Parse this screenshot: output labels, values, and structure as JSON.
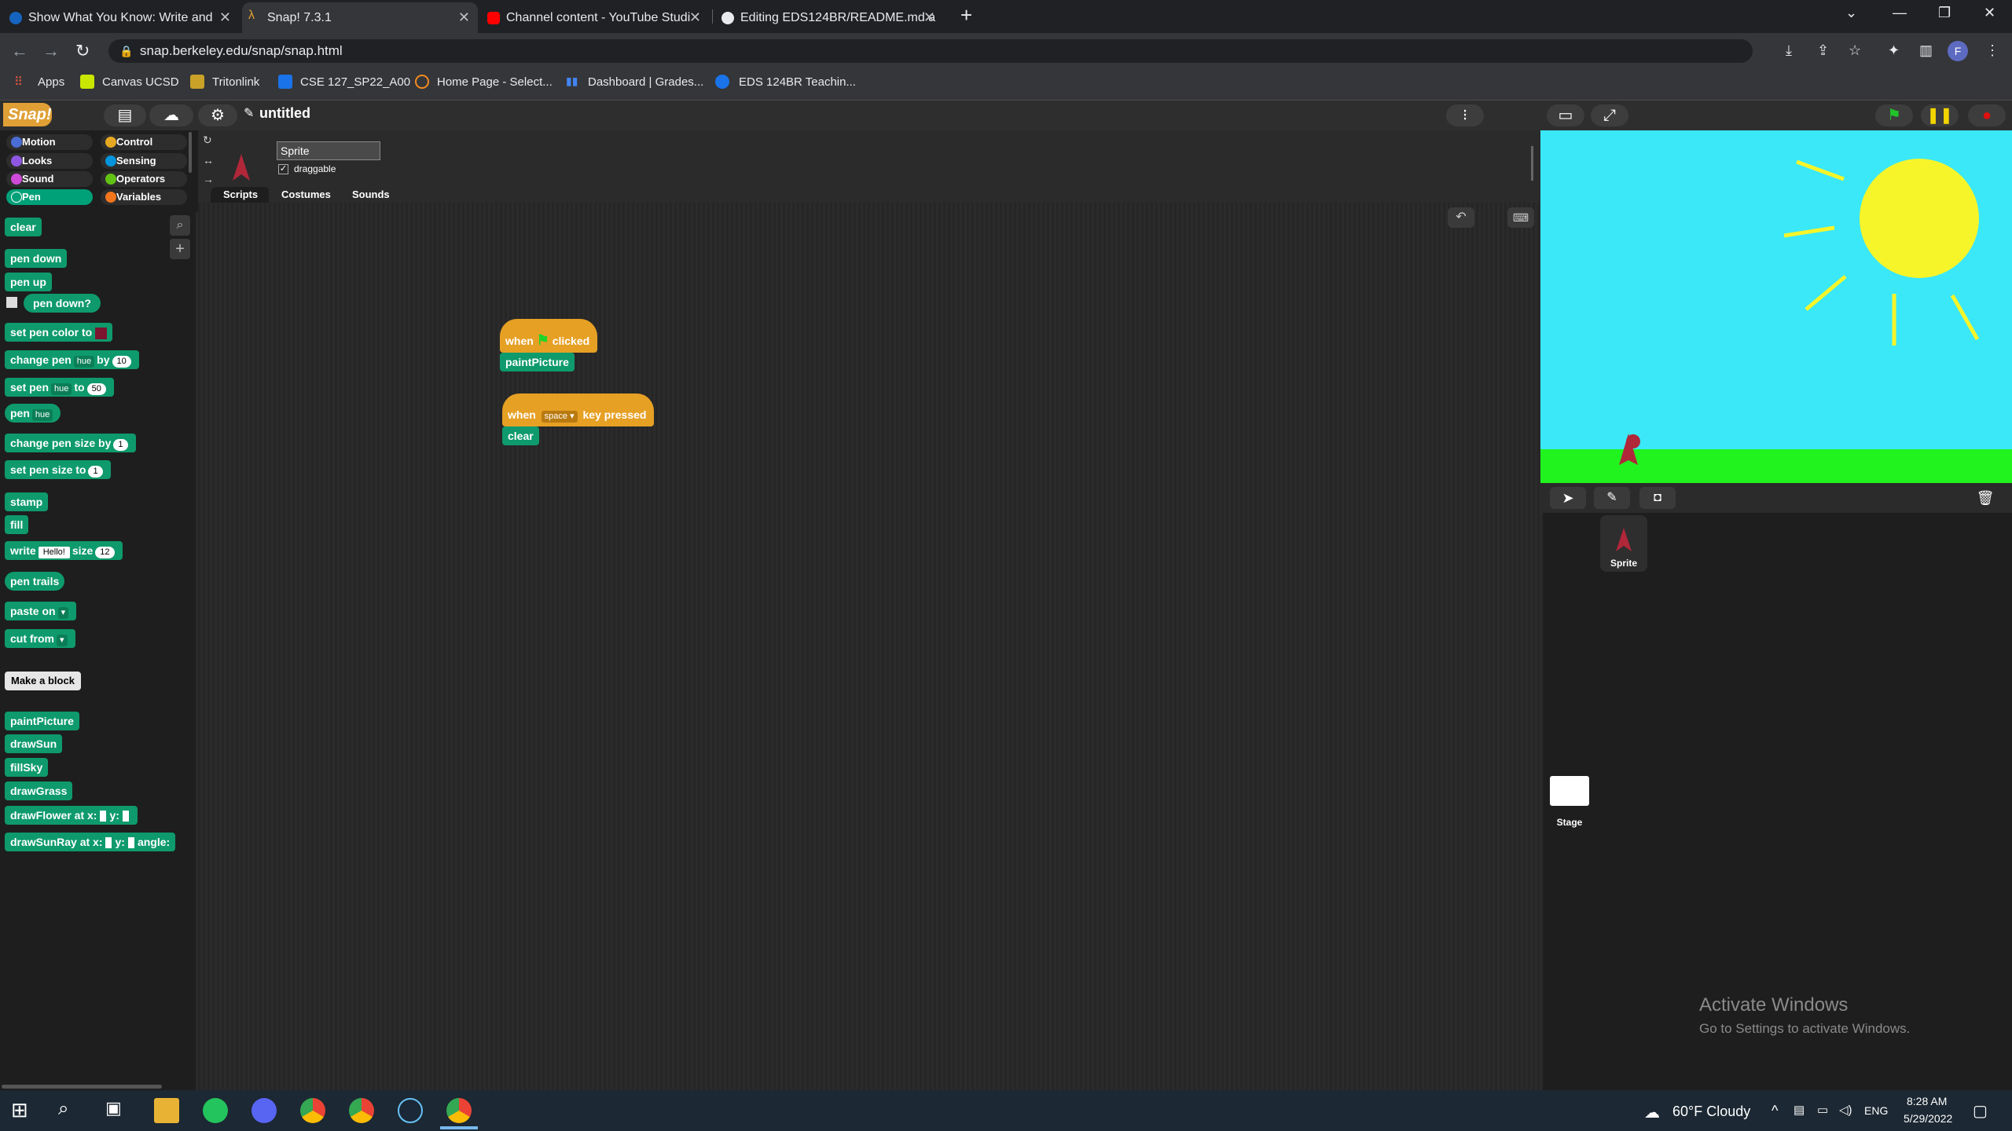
{
  "browser": {
    "tabs": [
      {
        "title": "Show What You Know: Write and",
        "active": false
      },
      {
        "title": "Snap! 7.3.1",
        "active": true
      },
      {
        "title": "Channel content - YouTube Studi",
        "active": false
      },
      {
        "title": "Editing EDS124BR/README.md a",
        "active": false
      }
    ],
    "new_tab": "+",
    "url": "snap.berkeley.edu/snap/snap.html",
    "bookmarks": [
      "Apps",
      "Canvas UCSD",
      "Tritonlink",
      "CSE 127_SP22_A00",
      "Home Page - Select...",
      "Dashboard | Grades...",
      "EDS 124BR Teachin..."
    ]
  },
  "snap": {
    "logo": "Snap!",
    "project_title": "untitled",
    "categories": [
      {
        "label": "Motion",
        "color": "#4a6cd4"
      },
      {
        "label": "Control",
        "color": "#e6a822"
      },
      {
        "label": "Looks",
        "color": "#8f56e3"
      },
      {
        "label": "Sensing",
        "color": "#0494dc"
      },
      {
        "label": "Sound",
        "color": "#cf4ad9"
      },
      {
        "label": "Operators",
        "color": "#62c213"
      },
      {
        "label": "Pen",
        "color": "#00a178"
      },
      {
        "label": "Variables",
        "color": "#f3761d"
      }
    ],
    "sprite": {
      "name": "Sprite",
      "draggable_label": "draggable"
    },
    "editor_tabs": [
      "Scripts",
      "Costumes",
      "Sounds"
    ],
    "palette": {
      "clear": "clear",
      "pen_down": "pen down",
      "pen_up": "pen up",
      "pen_down_q": "pen down?",
      "set_pen_color": "set pen color to",
      "change_pen": "change pen",
      "hue": "hue",
      "by": "by",
      "to": "to",
      "ten": "10",
      "fifty": "50",
      "set_pen": "set pen",
      "pen": "pen",
      "change_pen_size": "change pen size by",
      "set_pen_size": "set pen size to",
      "one": "1",
      "stamp": "stamp",
      "fill": "fill",
      "write": "write",
      "hello": "Hello!",
      "size": "size",
      "twelve": "12",
      "pen_trails": "pen trails",
      "paste_on": "paste on",
      "cut_from": "cut from",
      "make_block": "Make a block",
      "custom": [
        "paintPicture",
        "drawSun",
        "fillSky",
        "drawGrass"
      ],
      "draw_flower": "drawFlower at x:",
      "draw_sun_ray": "drawSunRay at x:",
      "y": "y:",
      "angle": "angle:"
    },
    "scripts": {
      "when": "when",
      "clicked": "clicked",
      "paint_picture": "paintPicture",
      "space": "space",
      "key_pressed": "key pressed",
      "clear": "clear"
    },
    "corral": {
      "sprite_label": "Sprite",
      "stage_label": "Stage"
    }
  },
  "watermark": {
    "line1": "Activate Windows",
    "line2": "Go to Settings to activate Windows."
  },
  "taskbar": {
    "weather": "60°F  Cloudy",
    "lang": "ENG",
    "time": "8:28 AM",
    "date": "5/29/2022"
  }
}
